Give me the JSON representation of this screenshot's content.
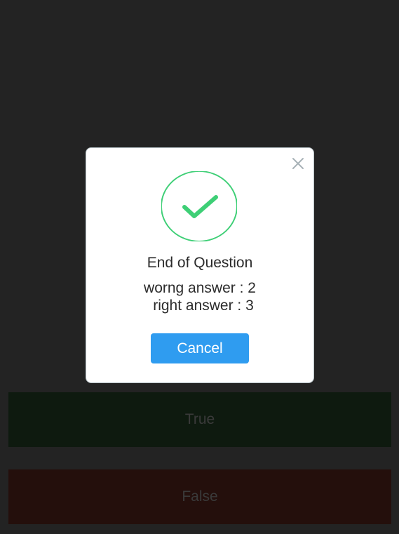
{
  "answers": {
    "true_label": "True",
    "false_label": "False"
  },
  "modal": {
    "title": "End of Question",
    "wrong_answer": "worng answer : 2",
    "right_answer": "right answer : 3",
    "cancel_label": "Cancel",
    "success_icon": "check-circle-icon",
    "close_icon": "close-icon"
  },
  "colors": {
    "background": "#232323",
    "true_button": "#0e1a0f",
    "false_button": "#240f0c",
    "check": "#3ecf76",
    "cancel_button": "#2f9cf0"
  }
}
